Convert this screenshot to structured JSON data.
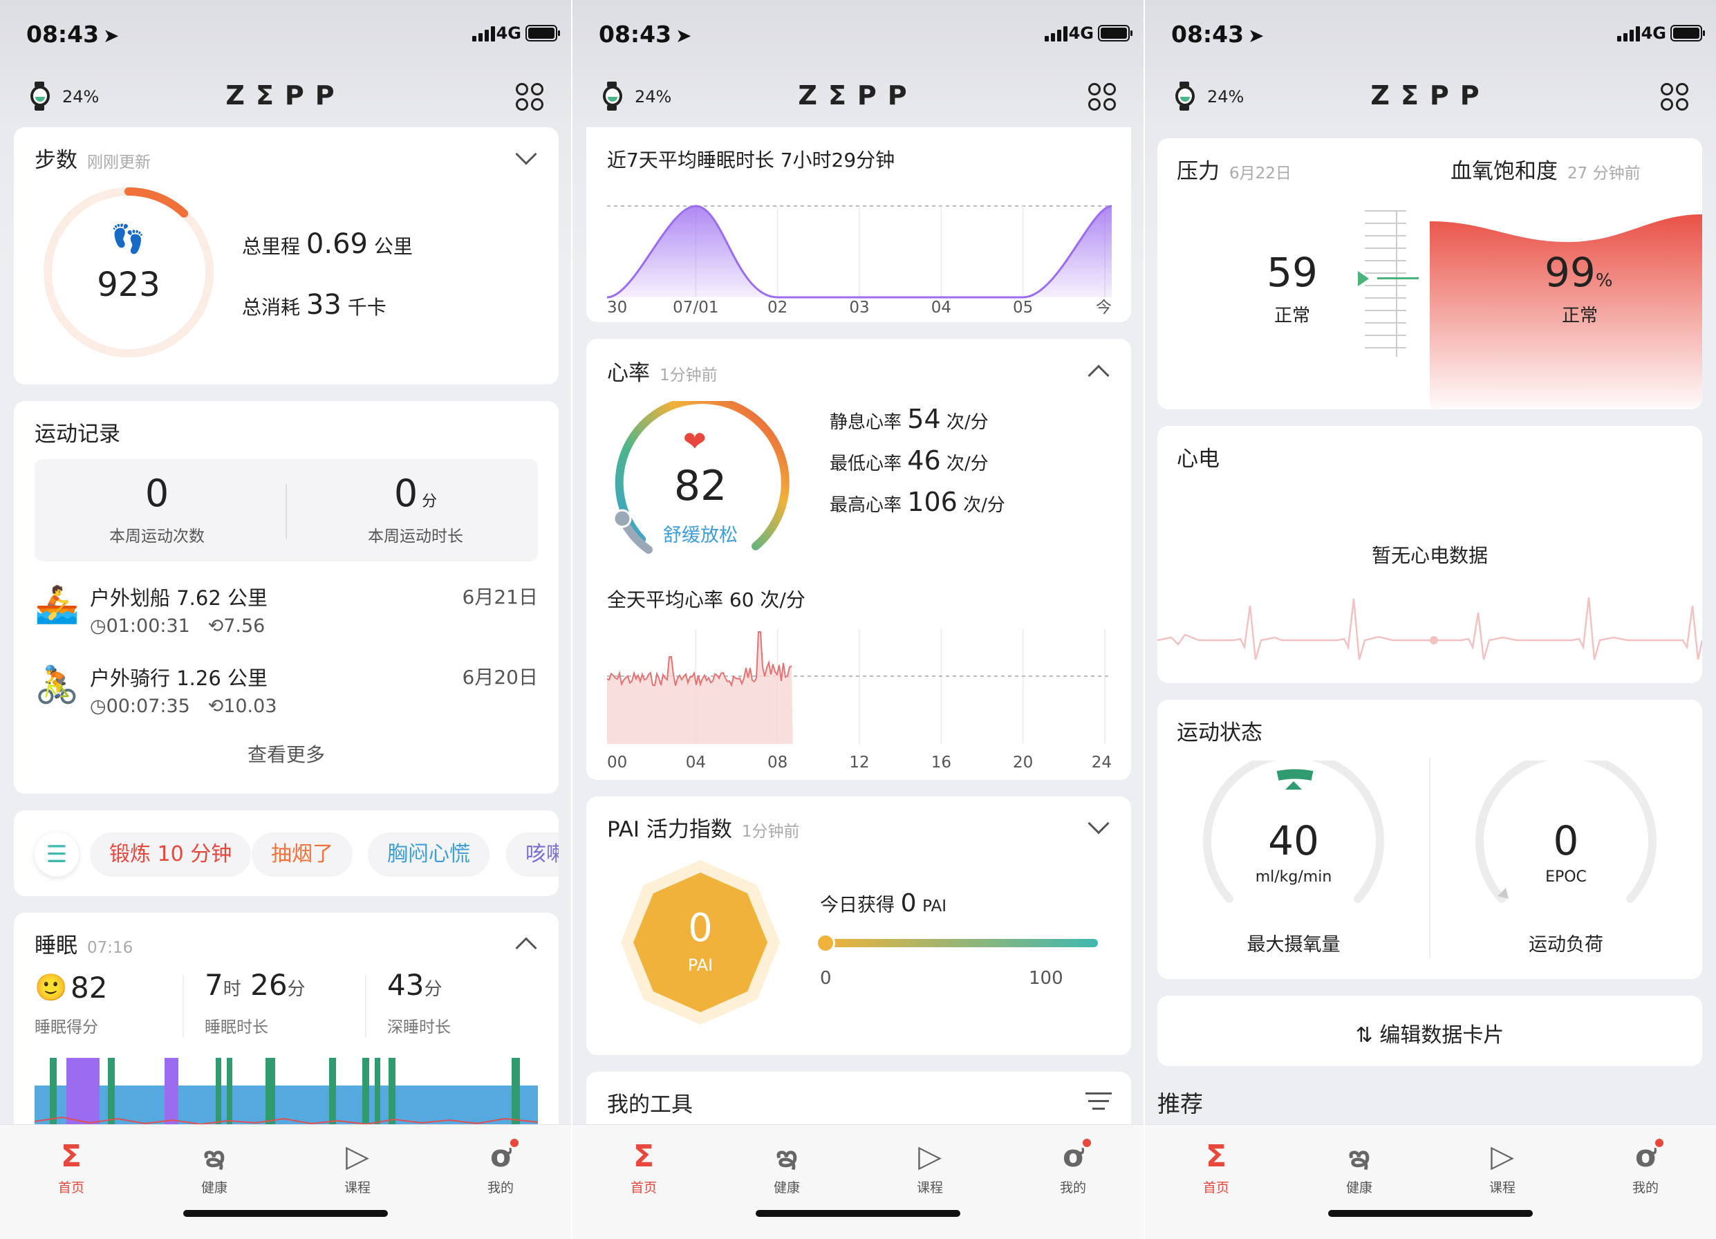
{
  "status": {
    "time": "08:43",
    "network": "4G"
  },
  "appbar": {
    "battery": "24%",
    "logo": "ZΣPP"
  },
  "colors": {
    "accent": "#e8483c",
    "steps": "#f0723a",
    "sleep_purple": "#9b6cf0",
    "sleep_green": "#2f9b6e",
    "sleep_blue": "#56a9df",
    "pai": "#f0b23a",
    "teal": "#3fb8b0",
    "stress_green": "#4ab37a"
  },
  "tabs": [
    {
      "label": "首页",
      "icon": "sigma-home-icon"
    },
    {
      "label": "健康",
      "icon": "health-knot-icon"
    },
    {
      "label": "课程",
      "icon": "play-course-icon"
    },
    {
      "label": "我的",
      "icon": "profile-icon"
    }
  ],
  "steps": {
    "title": "步数",
    "updated": "刚刚更新",
    "count": "923",
    "distance_label": "总里程",
    "distance": "0.69",
    "distance_unit": "公里",
    "calorie_label": "总消耗",
    "calories": "33",
    "calorie_unit": "千卡",
    "goal_fraction": 0.12
  },
  "workouts": {
    "title": "运动记录",
    "weekly_count": "0",
    "weekly_count_label": "本周运动次数",
    "weekly_duration": "0",
    "weekly_duration_unit": "分",
    "weekly_duration_label": "本周运动时长",
    "items": [
      {
        "name": "户外划船 7.62 公里",
        "date": "6月21日",
        "duration": "01:00:31",
        "pace": "7.56",
        "icon": "rowing-icon"
      },
      {
        "name": "户外骑行 1.26 公里",
        "date": "6月20日",
        "duration": "00:07:35",
        "pace": "10.03",
        "icon": "cycling-icon"
      }
    ],
    "more": "查看更多"
  },
  "quick_tags": [
    "锻炼 10 分钟",
    "抽烟了",
    "胸闷心慌",
    "咳嗽"
  ],
  "sleep": {
    "title": "睡眠",
    "time": "07:16",
    "score": "82",
    "score_label": "睡眠得分",
    "hours": "7",
    "hours_unit": "时",
    "minutes": "26",
    "minutes_unit": "分",
    "duration_label": "睡眠时长",
    "deep": "43",
    "deep_unit": "分",
    "deep_label": "深睡时长"
  },
  "sleep_week": {
    "title": "近7天平均睡眠时长 7小时29分钟",
    "chart_data": {
      "type": "area",
      "categories": [
        "30",
        "07/01",
        "02",
        "03",
        "04",
        "05",
        "今"
      ],
      "values": [
        0,
        7.5,
        0,
        0,
        0,
        0,
        7.5
      ]
    }
  },
  "heart": {
    "title": "心率",
    "updated": "1分钟前",
    "value": "82",
    "zone": "舒缓放松",
    "resting_label": "静息心率",
    "resting": "54",
    "min_label": "最低心率",
    "min": "46",
    "max_label": "最高心率",
    "max": "106",
    "unit": "次/分",
    "avg_title": "全天平均心率 60 次/分",
    "chart_data": {
      "type": "line",
      "categories": [
        "00",
        "04",
        "08",
        "12",
        "16",
        "20",
        "24"
      ],
      "avg": 60
    }
  },
  "pai": {
    "title": "PAI 活力指数",
    "updated": "1分钟前",
    "value": "0",
    "unit": "PAI",
    "today_label": "今日获得",
    "today": "0",
    "today_unit": "PAI",
    "min": "0",
    "max": "100",
    "progress": 0
  },
  "tools": {
    "title": "我的工具"
  },
  "stress": {
    "title": "压力",
    "date": "6月22日",
    "value": "59",
    "status": "正常"
  },
  "spo2": {
    "title": "血氧饱和度",
    "updated": "27 分钟前",
    "value": "99",
    "unit": "%",
    "status": "正常"
  },
  "ecg": {
    "title": "心电",
    "empty": "暂无心电数据"
  },
  "exercise_status": {
    "title": "运动状态",
    "vo2": "40",
    "vo2_unit": "ml/kg/min",
    "vo2_label": "最大摄氧量",
    "epoc": "0",
    "epoc_unit": "EPOC",
    "epoc_label": "运动负荷"
  },
  "edit_cards": "编辑数据卡片",
  "recommend": "推荐"
}
